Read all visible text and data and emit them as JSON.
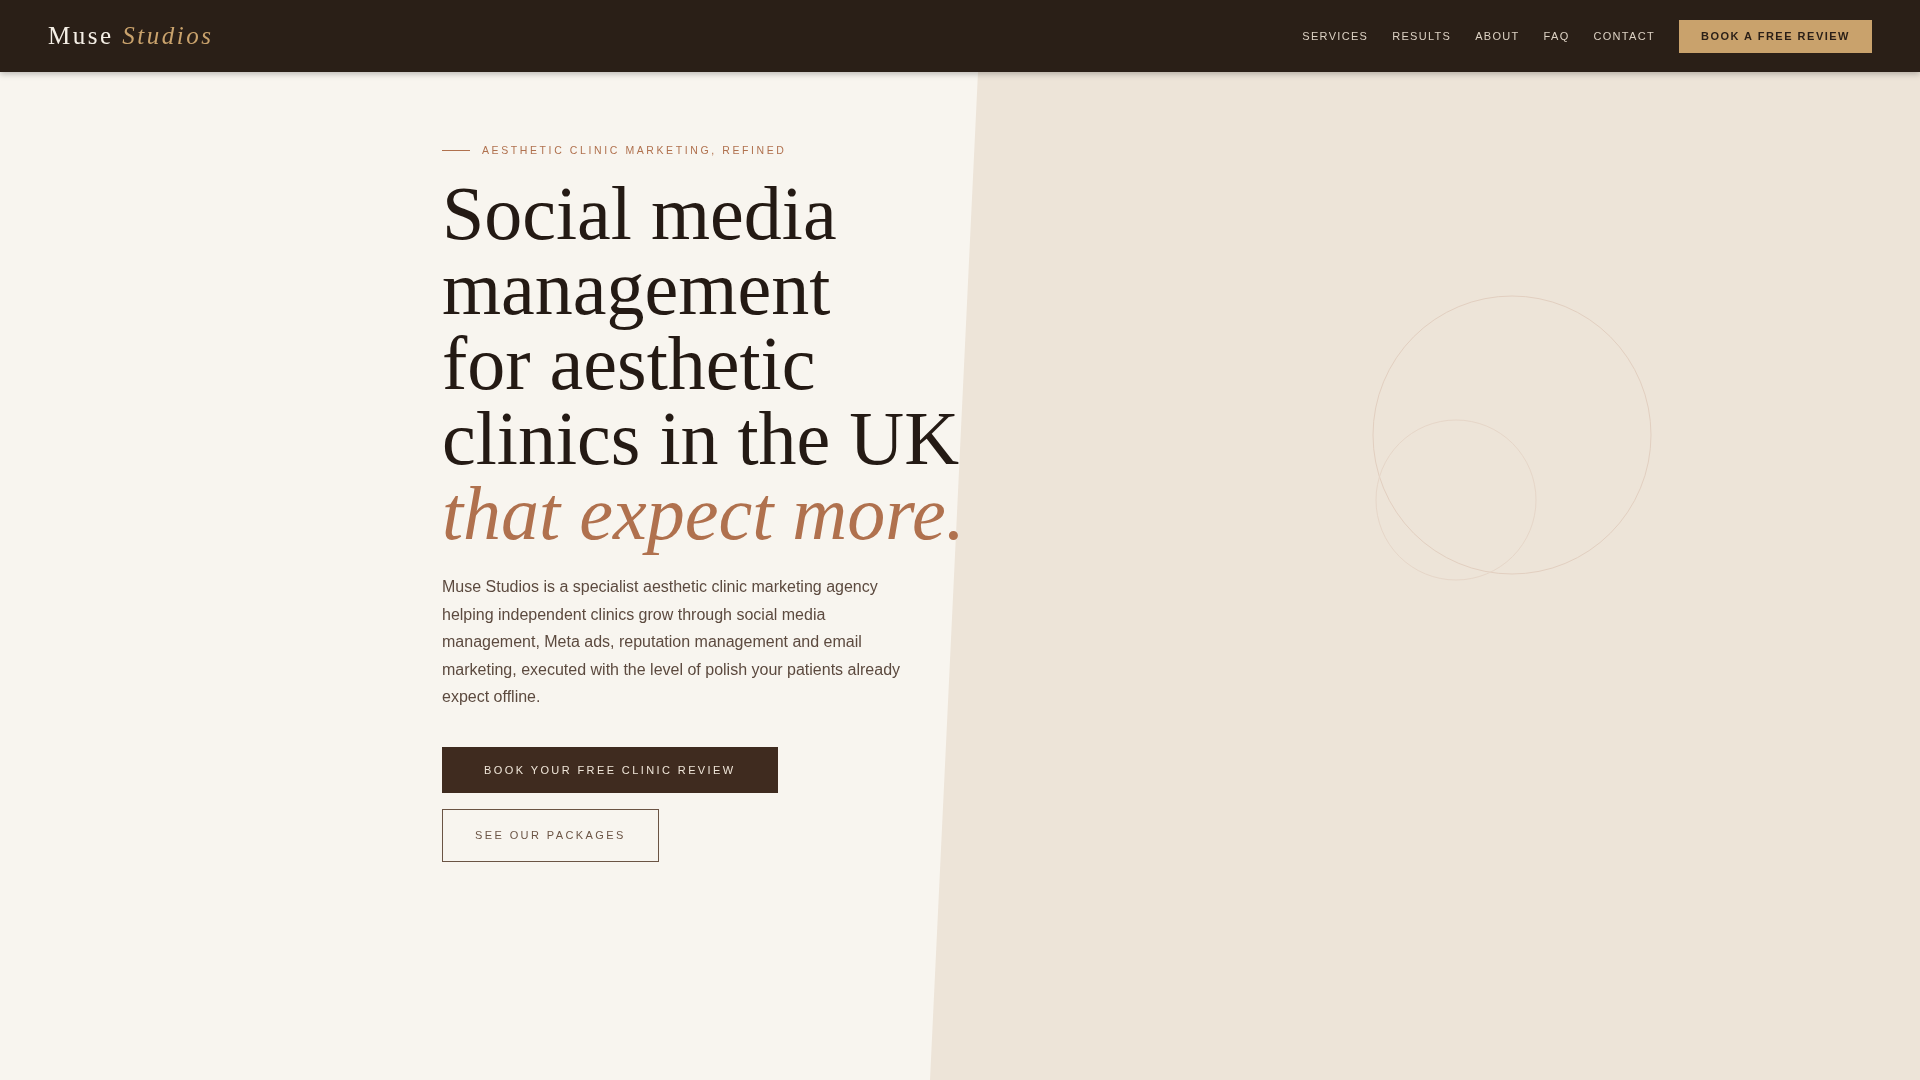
{
  "header": {
    "logo": {
      "main": "Muse",
      "accent": "Studios"
    },
    "nav": [
      {
        "label": "SERVICES"
      },
      {
        "label": "RESULTS"
      },
      {
        "label": "ABOUT"
      },
      {
        "label": "FAQ"
      },
      {
        "label": "CONTACT"
      }
    ],
    "cta": "BOOK A FREE REVIEW"
  },
  "hero": {
    "eyebrow": "AESTHETIC CLINIC MARKETING, REFINED",
    "heading_lines": [
      "Social media",
      "management",
      "for aesthetic",
      "clinics in the UK"
    ],
    "heading_accent": "that expect more.",
    "body": "Muse Studios is a specialist aesthetic clinic marketing agency helping independent clinics grow through social media management, Meta ads, reputation management and email marketing, executed with the level of polish your patients already expect offline.",
    "buttons": [
      {
        "kind": "primary",
        "label": "BOOK YOUR FREE CLINIC REVIEW"
      },
      {
        "kind": "secondary",
        "label": "SEE OUR PACKAGES"
      }
    ]
  }
}
